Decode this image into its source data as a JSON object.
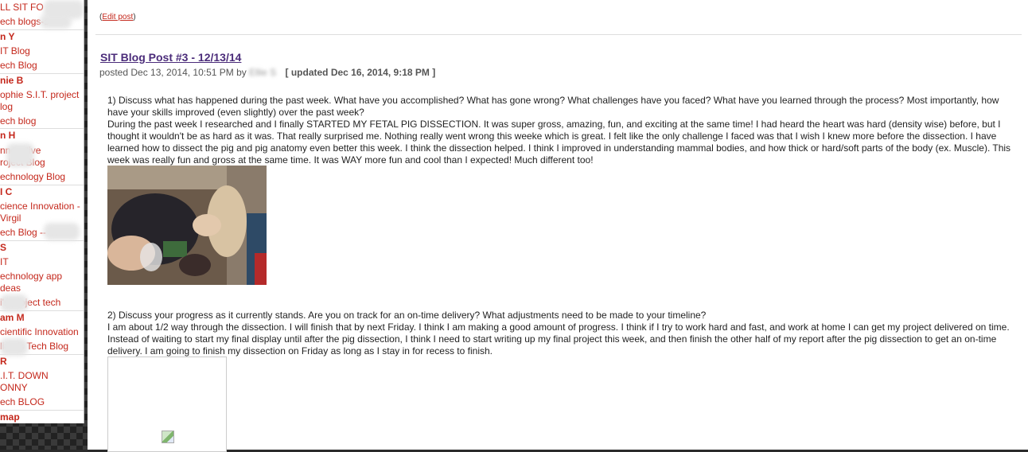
{
  "sidebar": {
    "items": [
      {
        "text": "LL SIT FO",
        "kind": "link"
      },
      {
        "text": "ech blogs-s",
        "kind": "link"
      },
      {
        "text": "n Y",
        "kind": "head"
      },
      {
        "text": "IT Blog",
        "kind": "link"
      },
      {
        "text": "ech Blog",
        "kind": "link"
      },
      {
        "text": "nie B",
        "kind": "head"
      },
      {
        "text": "ophie S.I.T. project",
        "kind": "link"
      },
      {
        "text": "log",
        "kind": "link"
      },
      {
        "text": "ech blog",
        "kind": "link"
      },
      {
        "text": "n H",
        "kind": "head"
      },
      {
        "text": "nnovative",
        "kind": "link"
      },
      {
        "text": "roject Blog",
        "kind": "link"
      },
      {
        "text": "echnology Blog",
        "kind": "link"
      },
      {
        "text": "I C",
        "kind": "head"
      },
      {
        "text": "cience Innovation -",
        "kind": "link"
      },
      {
        "text": "Virgil",
        "kind": "link"
      },
      {
        "text": "ech Blog -- Vi",
        "kind": "link"
      },
      {
        "text": "S",
        "kind": "head"
      },
      {
        "text": "IT",
        "kind": "link"
      },
      {
        "text": "echnology app",
        "kind": "link"
      },
      {
        "text": "deas",
        "kind": "link"
      },
      {
        "text": "i's project tech",
        "kind": "link"
      },
      {
        "text": "am M",
        "kind": "head"
      },
      {
        "text": "cientific Innovation",
        "kind": "link"
      },
      {
        "text": "liam's Tech Blog",
        "kind": "link"
      },
      {
        "text": "R",
        "kind": "head"
      },
      {
        "text": ".I.T. DOWN",
        "kind": "link"
      },
      {
        "text": "ONNY",
        "kind": "link"
      },
      {
        "text": "ech BLOG",
        "kind": "link"
      },
      {
        "text": "map",
        "kind": "head"
      }
    ]
  },
  "post": {
    "edit_open": "(",
    "edit_label": "Edit post",
    "edit_close": ")",
    "title": "SIT Blog Post #3 - 12/13/14",
    "posted": "posted Dec 13, 2014, 10:51 PM by",
    "author": "Ellie S",
    "updated": "[ updated Dec 16, 2014, 9:18 PM ]",
    "q1": "1) Discuss what has happened during the past week. What have you accomplished? What has gone wrong? What challenges have you faced? What have you learned through the process? Most importantly, how have your skills improved (even slightly) over the past week?",
    "a1": "During the past week I researched and I finally STARTED MY FETAL PIG DISSECTION. It was super gross, amazing, fun, and exciting at the same time! I had heard the heart was hard (density wise) before, but I thought it wouldn't be as hard as it was. That really surprised me. Nothing really went wrong this weeke which is great. I felt like the only challenge I faced was that I wish I knew more before the dissection. I have learned how to dissect the pig and pig anatomy even better this week. I think the dissection helped. I think I improved in understanding mammal bodies, and how thick or hard/soft parts of the body (ex. Muscle). This week was really fun and gross at the same time. It was WAY more fun and cool than I expected! Much different too!",
    "q2": "2) Discuss your progress as it currently stands. Are you on track for an on-time delivery? What adjustments need to be made to your timeline?",
    "a2": "I am about 1/2 way through the dissection. I will finish that by next Friday. I think I am making a good amount of progress. I think if I try to work hard and fast, and work at home I can get my project delivered on time. Instead of waiting to start my final display until after the pig dissection, I think I need to start writing up my final project this week, and then finish the other half of my report after the pig dissection to get an on-time delivery. I am going to finish my dissection on Friday as long as I stay in for recess to finish."
  }
}
